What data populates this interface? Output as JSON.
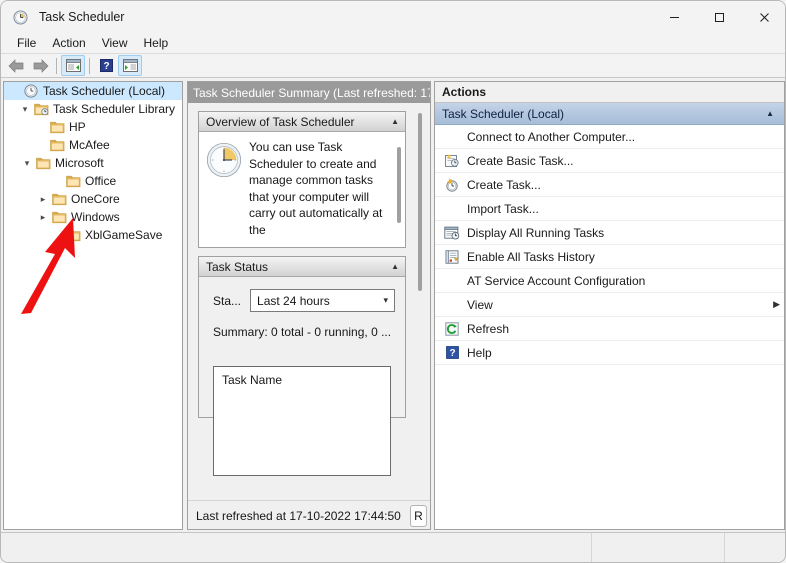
{
  "window": {
    "title": "Task Scheduler",
    "icon": "clock-icon",
    "controls": {
      "minimize": "—",
      "maximize": "☐",
      "close": "✕"
    }
  },
  "menubar": {
    "items": [
      {
        "label": "File",
        "name": "menu-file"
      },
      {
        "label": "Action",
        "name": "menu-action"
      },
      {
        "label": "View",
        "name": "menu-view"
      },
      {
        "label": "Help",
        "name": "menu-help"
      }
    ]
  },
  "toolbar": {
    "items": [
      {
        "name": "back-arrow-icon",
        "glyph": "⇦"
      },
      {
        "name": "forward-arrow-icon",
        "glyph": "⇨"
      },
      {
        "name": "show-hide-tree-icon",
        "glyph": "panel"
      },
      {
        "name": "help-icon",
        "glyph": "?"
      },
      {
        "name": "show-hide-action-pane-icon",
        "glyph": "panel"
      }
    ]
  },
  "tree": {
    "nodes": [
      {
        "label": "Task Scheduler (Local)",
        "indent": 0,
        "chevron": "none",
        "icon": "clock-icon",
        "selected": true,
        "name": "tree-item-task-scheduler-local"
      },
      {
        "label": "Task Scheduler Library",
        "indent": 1,
        "chevron": "expanded",
        "icon": "library-folder-icon",
        "selected": false,
        "name": "tree-item-task-scheduler-library"
      },
      {
        "label": "HP",
        "indent": 2,
        "chevron": "none",
        "icon": "folder-icon",
        "selected": false,
        "name": "tree-item-hp"
      },
      {
        "label": "McAfee",
        "indent": 2,
        "chevron": "none",
        "icon": "folder-icon",
        "selected": false,
        "name": "tree-item-mcafee"
      },
      {
        "label": "Microsoft",
        "indent": 2,
        "chevron": "expanded",
        "icon": "folder-icon",
        "selected": false,
        "name": "tree-item-microsoft"
      },
      {
        "label": "Office",
        "indent": 3,
        "chevron": "none",
        "icon": "folder-icon",
        "selected": false,
        "name": "tree-item-office"
      },
      {
        "label": "OneCore",
        "indent": 3,
        "chevron": "collapsed",
        "icon": "folder-icon",
        "selected": false,
        "name": "tree-item-onecore"
      },
      {
        "label": "Windows",
        "indent": 3,
        "chevron": "collapsed",
        "icon": "folder-icon",
        "selected": false,
        "name": "tree-item-windows"
      },
      {
        "label": "XblGameSave",
        "indent": 3,
        "chevron": "none",
        "icon": "folder-icon",
        "selected": false,
        "name": "tree-item-xblgamesave"
      }
    ]
  },
  "center": {
    "header": "Task Scheduler Summary (Last refreshed: 17-",
    "overview": {
      "title": "Overview of Task Scheduler",
      "collapse_glyph": "▲",
      "icon": "clock-icon",
      "text": "You can use Task Scheduler to create and manage common tasks that your computer will carry out automatically at the"
    },
    "task_status": {
      "title": "Task Status",
      "collapse_glyph": "▲",
      "status_label": "Sta...",
      "combo_value": "Last 24 hours",
      "combo_glyph": "⌄",
      "summary": "Summary: 0 total - 0 running, 0 ...",
      "column_header": "Task Name"
    },
    "footer": {
      "last_refreshed": "Last refreshed at 17-10-2022 17:44:50",
      "refresh_button": "R"
    }
  },
  "actions": {
    "title": "Actions",
    "group": {
      "label": "Task Scheduler (Local)",
      "collapse_glyph": "▲"
    },
    "items": [
      {
        "label": "Connect to Another Computer...",
        "icon": "none",
        "submenu": "",
        "name": "action-connect-to-another-computer"
      },
      {
        "label": "Create Basic Task...",
        "icon": "create-basic-task-icon",
        "submenu": "",
        "name": "action-create-basic-task"
      },
      {
        "label": "Create Task...",
        "icon": "create-task-icon",
        "submenu": "",
        "name": "action-create-task"
      },
      {
        "label": "Import Task...",
        "icon": "none",
        "submenu": "",
        "name": "action-import-task"
      },
      {
        "label": "Display All Running Tasks",
        "icon": "display-running-tasks-icon",
        "submenu": "",
        "name": "action-display-all-running-tasks"
      },
      {
        "label": "Enable All Tasks History",
        "icon": "enable-history-icon",
        "submenu": "",
        "name": "action-enable-all-tasks-history"
      },
      {
        "label": "AT Service Account Configuration",
        "icon": "none",
        "submenu": "",
        "name": "action-at-service-account-configuration"
      },
      {
        "label": "View",
        "icon": "none",
        "submenu": "▶",
        "name": "action-view"
      },
      {
        "label": "Refresh",
        "icon": "refresh-icon",
        "submenu": "",
        "name": "action-refresh"
      },
      {
        "label": "Help",
        "icon": "help-icon",
        "submenu": "",
        "name": "action-help"
      }
    ]
  },
  "statusbar": {
    "segments": [
      "",
      "",
      ""
    ]
  },
  "annotation": {
    "type": "arrow",
    "color": "#ee1111",
    "points_to": "tree-item-windows-chevron"
  },
  "colors": {
    "selection_blue": "#cce8ff",
    "actions_group_blue": "#b3c7df",
    "header_gray": "#9a9a9a",
    "annotation_red": "#ee1111"
  }
}
